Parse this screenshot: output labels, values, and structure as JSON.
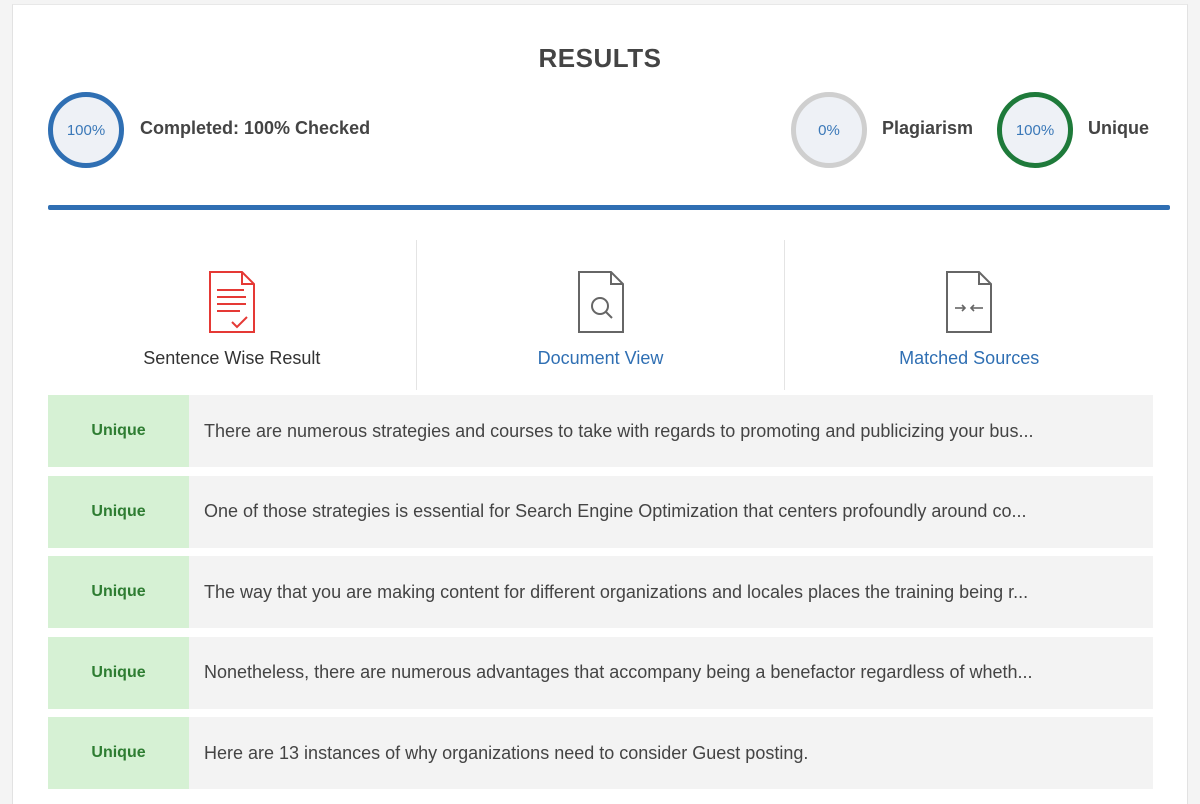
{
  "header": {
    "title": "RESULTS"
  },
  "stats": {
    "completed": {
      "value": "100%",
      "label": "Completed: 100% Checked"
    },
    "plagiarism": {
      "value": "0%",
      "label": "Plagiarism"
    },
    "unique": {
      "value": "100%",
      "label": "Unique"
    }
  },
  "tabs": [
    {
      "label": "Sentence Wise Result",
      "icon": "document-check-icon"
    },
    {
      "label": "Document View",
      "icon": "document-search-icon"
    },
    {
      "label": "Matched Sources",
      "icon": "document-compare-icon"
    }
  ],
  "rows": [
    {
      "status": "Unique",
      "text": "There are numerous strategies and courses to take with regards to promoting and publicizing your bus..."
    },
    {
      "status": "Unique",
      "text": "One of those strategies is essential for Search Engine Optimization that centers profoundly around co..."
    },
    {
      "status": "Unique",
      "text": "The way that you are making content for different organizations and locales places the training being r..."
    },
    {
      "status": "Unique",
      "text": "Nonetheless, there are numerous advantages that accompany being a benefactor regardless of wheth..."
    },
    {
      "status": "Unique",
      "text": "Here are 13 instances of why organizations need to consider Guest posting."
    }
  ],
  "colors": {
    "accent": "#2f6fb3",
    "unique_ring": "#1e7a3a",
    "plagiarism_ring": "#cfcfcf",
    "badge_bg": "#d6f1d4",
    "badge_text": "#2e7d32",
    "active_icon": "#e53935"
  }
}
